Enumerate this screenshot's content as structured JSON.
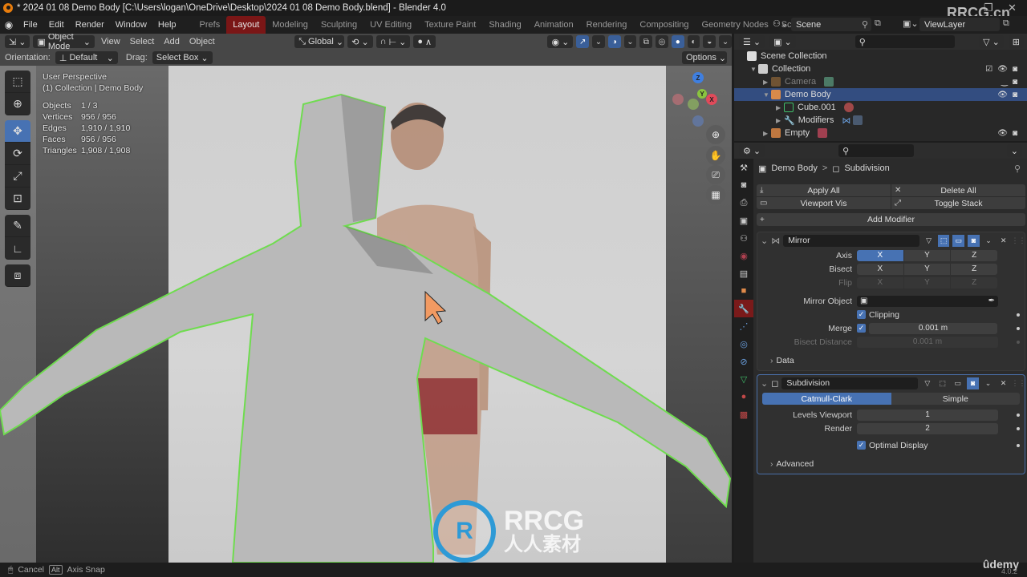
{
  "window": {
    "title": "* 2024 01 08 Demo Body [C:\\Users\\logan\\OneDrive\\Desktop\\2024 01 08 Demo Body.blend] - Blender 4.0",
    "controls": [
      "minimize",
      "maximize",
      "close"
    ]
  },
  "menubar": {
    "items": [
      "File",
      "Edit",
      "Render",
      "Window",
      "Help"
    ],
    "workspaces": [
      "Prefs",
      "Layout",
      "Modeling",
      "Sculpting",
      "UV Editing",
      "Texture Paint",
      "Shading",
      "Animation",
      "Rendering",
      "Compositing",
      "Geometry Nodes",
      "Scripting"
    ],
    "active_workspace": "Layout",
    "add_workspace": "+",
    "scene": "Scene",
    "view_layer": "ViewLayer"
  },
  "viewport": {
    "header": {
      "mode": "Object Mode",
      "menus": [
        "View",
        "Select",
        "Add",
        "Object"
      ],
      "transform_orientation": "Global",
      "options": "Options"
    },
    "tool_settings": {
      "orientation_label": "Orientation:",
      "orientation_value": "Default",
      "drag_label": "Drag:",
      "drag_value": "Select Box"
    },
    "overlay": {
      "view_name": "User Perspective",
      "collection_info": "(1) Collection | Demo Body",
      "stats": [
        {
          "label": "Objects",
          "value": "1 / 3"
        },
        {
          "label": "Vertices",
          "value": "956 / 956"
        },
        {
          "label": "Edges",
          "value": "1,910 / 1,910"
        },
        {
          "label": "Faces",
          "value": "956 / 956"
        },
        {
          "label": "Triangles",
          "value": "1,908 / 1,908"
        }
      ]
    },
    "gizmo_axes": [
      "Z",
      "Y",
      "X"
    ],
    "tools": [
      "select-box",
      "cursor",
      "move",
      "rotate",
      "scale",
      "transform",
      "annotate",
      "measure",
      "add-cube"
    ],
    "active_tool": "move",
    "watermark": {
      "line1": "RRCG",
      "line2": "人人素材"
    }
  },
  "outliner": {
    "root": "Scene Collection",
    "items": [
      {
        "name": "Collection",
        "depth": 1,
        "expanded": true,
        "selected": false,
        "dim": false
      },
      {
        "name": "Camera",
        "depth": 2,
        "expanded": false,
        "selected": false,
        "dim": true
      },
      {
        "name": "Demo Body",
        "depth": 2,
        "expanded": true,
        "selected": true,
        "dim": false
      },
      {
        "name": "Cube.001",
        "depth": 3,
        "expanded": false,
        "selected": false,
        "dim": false
      },
      {
        "name": "Modifiers",
        "depth": 3,
        "expanded": false,
        "selected": false,
        "dim": false
      },
      {
        "name": "Empty",
        "depth": 2,
        "expanded": false,
        "selected": false,
        "dim": false
      }
    ]
  },
  "properties": {
    "breadcrumb": {
      "object": "Demo Body",
      "separator": ">",
      "modifier": "Subdivision"
    },
    "actions": {
      "apply_all": "Apply All",
      "delete_all": "Delete All",
      "viewport_vis": "Viewport Vis",
      "toggle_stack": "Toggle Stack",
      "add_modifier": "Add Modifier"
    },
    "mirror": {
      "name": "Mirror",
      "axis_label": "Axis",
      "bisect_label": "Bisect",
      "flip_label": "Flip",
      "axes": [
        "X",
        "Y",
        "Z"
      ],
      "axis_active": "X",
      "mirror_object_label": "Mirror Object",
      "clipping_label": "Clipping",
      "clipping": true,
      "merge_label": "Merge",
      "merge": true,
      "merge_value": "0.001 m",
      "bisect_distance_label": "Bisect Distance",
      "bisect_distance_value": "0.001 m",
      "data_section": "Data"
    },
    "subdivision": {
      "name": "Subdivision",
      "types": [
        "Catmull-Clark",
        "Simple"
      ],
      "active_type": "Catmull-Clark",
      "levels_viewport_label": "Levels Viewport",
      "levels_viewport": "1",
      "render_label": "Render",
      "render": "2",
      "optimal_display_label": "Optimal Display",
      "optimal_display": true,
      "advanced_section": "Advanced"
    }
  },
  "statusbar": {
    "cancel": "Cancel",
    "alt_key": "Alt",
    "axis_snap": "Axis Snap",
    "version": "4.0.2",
    "brand": "ûdemy"
  },
  "corner_watermark": "RRCG.cn",
  "colors": {
    "accent_blue": "#4772b3",
    "active_workspace": "#7a1616",
    "selection_outline": "#6fdc4f",
    "outliner_selected": "#334d80"
  }
}
